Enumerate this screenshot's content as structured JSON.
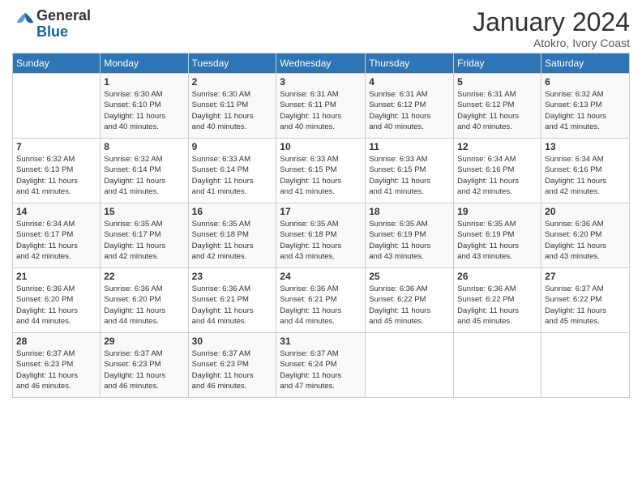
{
  "logo": {
    "text_general": "General",
    "text_blue": "Blue"
  },
  "title": "January 2024",
  "location": "Atokro, Ivory Coast",
  "days_of_week": [
    "Sunday",
    "Monday",
    "Tuesday",
    "Wednesday",
    "Thursday",
    "Friday",
    "Saturday"
  ],
  "weeks": [
    [
      {
        "num": "",
        "detail": ""
      },
      {
        "num": "1",
        "detail": "Sunrise: 6:30 AM\nSunset: 6:10 PM\nDaylight: 11 hours\nand 40 minutes."
      },
      {
        "num": "2",
        "detail": "Sunrise: 6:30 AM\nSunset: 6:11 PM\nDaylight: 11 hours\nand 40 minutes."
      },
      {
        "num": "3",
        "detail": "Sunrise: 6:31 AM\nSunset: 6:11 PM\nDaylight: 11 hours\nand 40 minutes."
      },
      {
        "num": "4",
        "detail": "Sunrise: 6:31 AM\nSunset: 6:12 PM\nDaylight: 11 hours\nand 40 minutes."
      },
      {
        "num": "5",
        "detail": "Sunrise: 6:31 AM\nSunset: 6:12 PM\nDaylight: 11 hours\nand 40 minutes."
      },
      {
        "num": "6",
        "detail": "Sunrise: 6:32 AM\nSunset: 6:13 PM\nDaylight: 11 hours\nand 41 minutes."
      }
    ],
    [
      {
        "num": "7",
        "detail": "Sunrise: 6:32 AM\nSunset: 6:13 PM\nDaylight: 11 hours\nand 41 minutes."
      },
      {
        "num": "8",
        "detail": "Sunrise: 6:32 AM\nSunset: 6:14 PM\nDaylight: 11 hours\nand 41 minutes."
      },
      {
        "num": "9",
        "detail": "Sunrise: 6:33 AM\nSunset: 6:14 PM\nDaylight: 11 hours\nand 41 minutes."
      },
      {
        "num": "10",
        "detail": "Sunrise: 6:33 AM\nSunset: 6:15 PM\nDaylight: 11 hours\nand 41 minutes."
      },
      {
        "num": "11",
        "detail": "Sunrise: 6:33 AM\nSunset: 6:15 PM\nDaylight: 11 hours\nand 41 minutes."
      },
      {
        "num": "12",
        "detail": "Sunrise: 6:34 AM\nSunset: 6:16 PM\nDaylight: 11 hours\nand 42 minutes."
      },
      {
        "num": "13",
        "detail": "Sunrise: 6:34 AM\nSunset: 6:16 PM\nDaylight: 11 hours\nand 42 minutes."
      }
    ],
    [
      {
        "num": "14",
        "detail": "Sunrise: 6:34 AM\nSunset: 6:17 PM\nDaylight: 11 hours\nand 42 minutes."
      },
      {
        "num": "15",
        "detail": "Sunrise: 6:35 AM\nSunset: 6:17 PM\nDaylight: 11 hours\nand 42 minutes."
      },
      {
        "num": "16",
        "detail": "Sunrise: 6:35 AM\nSunset: 6:18 PM\nDaylight: 11 hours\nand 42 minutes."
      },
      {
        "num": "17",
        "detail": "Sunrise: 6:35 AM\nSunset: 6:18 PM\nDaylight: 11 hours\nand 43 minutes."
      },
      {
        "num": "18",
        "detail": "Sunrise: 6:35 AM\nSunset: 6:19 PM\nDaylight: 11 hours\nand 43 minutes."
      },
      {
        "num": "19",
        "detail": "Sunrise: 6:35 AM\nSunset: 6:19 PM\nDaylight: 11 hours\nand 43 minutes."
      },
      {
        "num": "20",
        "detail": "Sunrise: 6:36 AM\nSunset: 6:20 PM\nDaylight: 11 hours\nand 43 minutes."
      }
    ],
    [
      {
        "num": "21",
        "detail": "Sunrise: 6:36 AM\nSunset: 6:20 PM\nDaylight: 11 hours\nand 44 minutes."
      },
      {
        "num": "22",
        "detail": "Sunrise: 6:36 AM\nSunset: 6:20 PM\nDaylight: 11 hours\nand 44 minutes."
      },
      {
        "num": "23",
        "detail": "Sunrise: 6:36 AM\nSunset: 6:21 PM\nDaylight: 11 hours\nand 44 minutes."
      },
      {
        "num": "24",
        "detail": "Sunrise: 6:36 AM\nSunset: 6:21 PM\nDaylight: 11 hours\nand 44 minutes."
      },
      {
        "num": "25",
        "detail": "Sunrise: 6:36 AM\nSunset: 6:22 PM\nDaylight: 11 hours\nand 45 minutes."
      },
      {
        "num": "26",
        "detail": "Sunrise: 6:36 AM\nSunset: 6:22 PM\nDaylight: 11 hours\nand 45 minutes."
      },
      {
        "num": "27",
        "detail": "Sunrise: 6:37 AM\nSunset: 6:22 PM\nDaylight: 11 hours\nand 45 minutes."
      }
    ],
    [
      {
        "num": "28",
        "detail": "Sunrise: 6:37 AM\nSunset: 6:23 PM\nDaylight: 11 hours\nand 46 minutes."
      },
      {
        "num": "29",
        "detail": "Sunrise: 6:37 AM\nSunset: 6:23 PM\nDaylight: 11 hours\nand 46 minutes."
      },
      {
        "num": "30",
        "detail": "Sunrise: 6:37 AM\nSunset: 6:23 PM\nDaylight: 11 hours\nand 46 minutes."
      },
      {
        "num": "31",
        "detail": "Sunrise: 6:37 AM\nSunset: 6:24 PM\nDaylight: 11 hours\nand 47 minutes."
      },
      {
        "num": "",
        "detail": ""
      },
      {
        "num": "",
        "detail": ""
      },
      {
        "num": "",
        "detail": ""
      }
    ]
  ]
}
